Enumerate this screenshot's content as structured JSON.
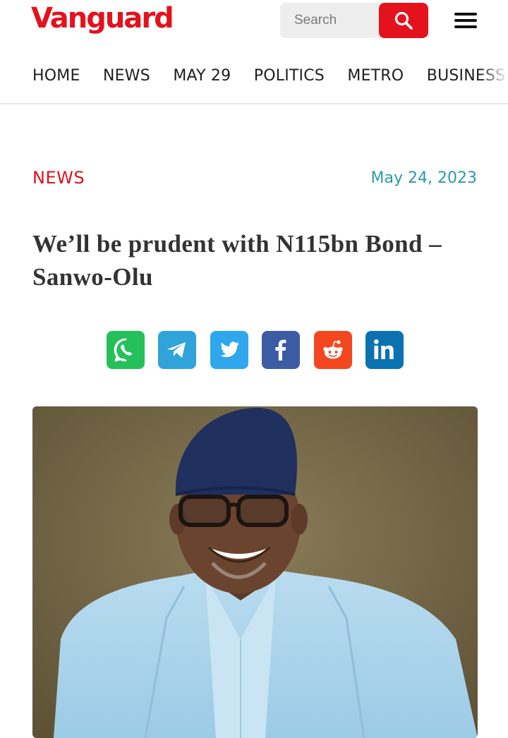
{
  "brand": {
    "logo_text": "Vanguard",
    "accent_color": "#e3121c"
  },
  "search": {
    "placeholder": "Search",
    "icon": "search-icon"
  },
  "menu": {
    "icon": "hamburger-menu-icon"
  },
  "nav": {
    "items": [
      "HOME",
      "NEWS",
      "MAY 29",
      "POLITICS",
      "METRO",
      "BUSINESS"
    ]
  },
  "article": {
    "category": "NEWS",
    "date": "May 24, 2023",
    "headline": "We’ll be prudent with N115bn Bond – Sanwo-Olu",
    "photo_alt": "Portrait of Sanwo-Olu in light blue attire and navy cap"
  },
  "share": {
    "buttons": [
      {
        "name": "whatsapp",
        "icon": "whatsapp-icon",
        "color": "#25c05a"
      },
      {
        "name": "telegram",
        "icon": "telegram-icon",
        "color": "#2fa3da"
      },
      {
        "name": "twitter",
        "icon": "twitter-icon",
        "color": "#2ea7ed"
      },
      {
        "name": "facebook",
        "icon": "facebook-icon",
        "color": "#3b5ba2"
      },
      {
        "name": "reddit",
        "icon": "reddit-icon",
        "color": "#f5471f"
      },
      {
        "name": "linkedin",
        "icon": "linkedin-icon",
        "color": "#0a72b1"
      }
    ]
  }
}
